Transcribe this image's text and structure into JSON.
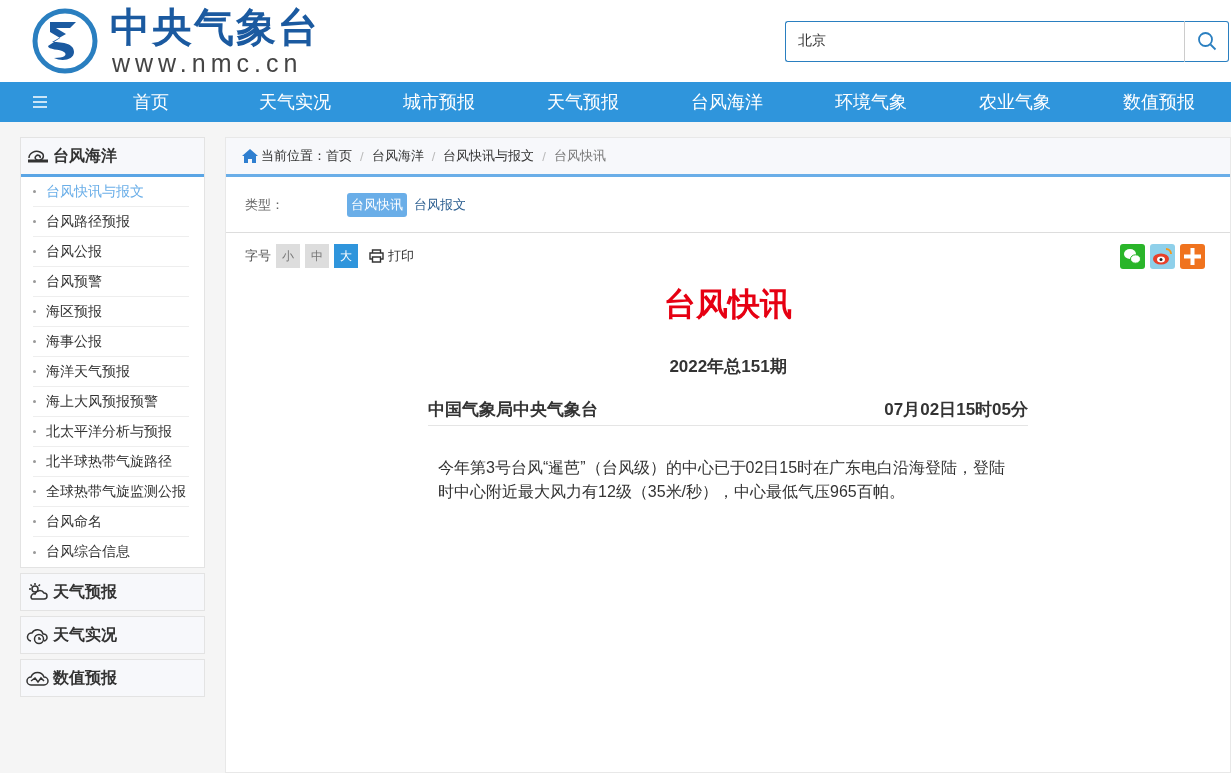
{
  "header": {
    "logo_title": "中央气象台",
    "logo_url": "www.nmc.cn",
    "search": {
      "value": "北京"
    }
  },
  "nav": {
    "items": [
      "首页",
      "天气实况",
      "城市预报",
      "天气预报",
      "台风海洋",
      "环境气象",
      "农业气象",
      "数值预报"
    ]
  },
  "sidebar": {
    "sections": [
      {
        "title": "台风海洋",
        "kind": "typhoon",
        "expanded": true,
        "items": [
          {
            "label": "台风快讯与报文",
            "selected": true
          },
          {
            "label": "台风路径预报",
            "selected": false
          },
          {
            "label": "台风公报",
            "selected": false
          },
          {
            "label": "台风预警",
            "selected": false
          },
          {
            "label": "海区预报",
            "selected": false
          },
          {
            "label": "海事公报",
            "selected": false
          },
          {
            "label": "海洋天气预报",
            "selected": false
          },
          {
            "label": "海上大风预报预警",
            "selected": false
          },
          {
            "label": "北太平洋分析与预报",
            "selected": false
          },
          {
            "label": "北半球热带气旋路径",
            "selected": false
          },
          {
            "label": "全球热带气旋监测公报",
            "selected": false
          },
          {
            "label": "台风命名",
            "selected": false
          },
          {
            "label": "台风综合信息",
            "selected": false
          }
        ]
      },
      {
        "title": "天气预报",
        "kind": "forecast",
        "expanded": false
      },
      {
        "title": "天气实况",
        "kind": "observation",
        "expanded": false
      },
      {
        "title": "数值预报",
        "kind": "numeric",
        "expanded": false
      }
    ]
  },
  "breadcrumb": {
    "prefix": "当前位置：",
    "separator": "/",
    "items": [
      "首页",
      "台风海洋",
      "台风快讯与报文",
      "台风快讯"
    ]
  },
  "type_filter": {
    "label": "类型：",
    "options": [
      {
        "label": "台风快讯",
        "selected": true
      },
      {
        "label": "台风报文",
        "selected": false
      }
    ]
  },
  "font_size": {
    "label": "字号",
    "options": [
      {
        "label": "小",
        "selected": false
      },
      {
        "label": "中",
        "selected": false
      },
      {
        "label": "大",
        "selected": true
      }
    ],
    "print": "打印"
  },
  "article": {
    "title": "台风快讯",
    "issue": "2022年总151期",
    "source": "中国气象局中央气象台",
    "time": "07月02日15时05分",
    "body": "今年第3号台风“暹芭”（台风级）的中心已于02日15时在广东电白沿海登陆，登陆时中心附近最大风力有12级（35米/秒），中心最低气压965百帕。"
  }
}
